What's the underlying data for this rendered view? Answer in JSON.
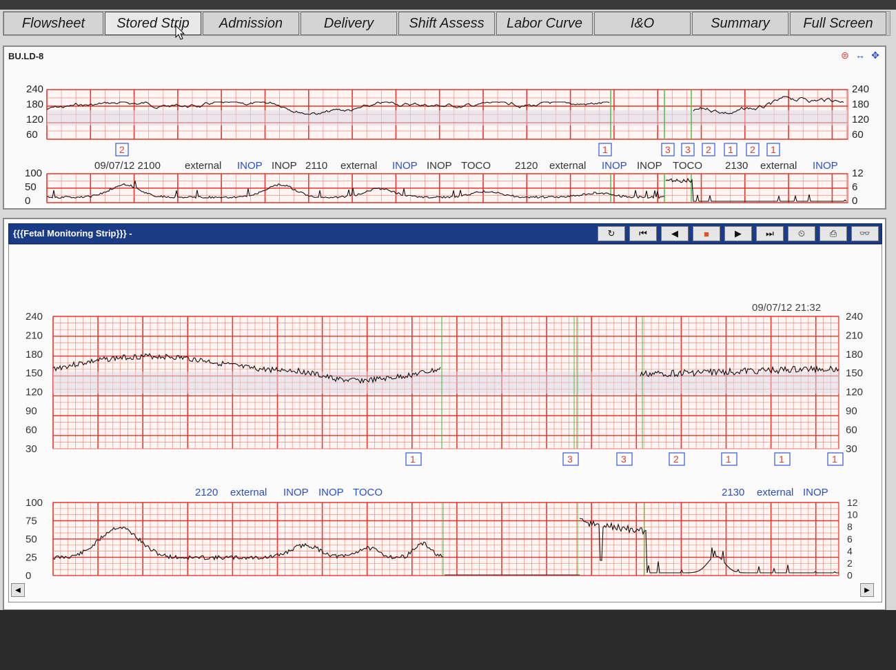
{
  "tabs": [
    {
      "label": "Flowsheet"
    },
    {
      "label": "Stored Strip",
      "active": true
    },
    {
      "label": "Admission"
    },
    {
      "label": "Delivery"
    },
    {
      "label": "Shift Assess"
    },
    {
      "label": "Labor Curve"
    },
    {
      "label": "I&O"
    },
    {
      "label": "Summary"
    },
    {
      "label": "Full Screen"
    }
  ],
  "overview": {
    "bed_label": "BU.LD-8",
    "icons": [
      "record-icon",
      "expand-horizontal-icon",
      "move-icon"
    ],
    "fhr_ticks_left": [
      "240",
      "180",
      "120",
      "60"
    ],
    "fhr_ticks_right": [
      "240",
      "180",
      "120",
      "60"
    ],
    "markers": [
      {
        "label": "2",
        "color": "red"
      },
      {
        "label": "1",
        "color": "red"
      },
      {
        "label": "3",
        "color": "red"
      },
      {
        "label": "3",
        "color": "red"
      },
      {
        "label": "2",
        "color": "red"
      },
      {
        "label": "1",
        "color": "red"
      },
      {
        "label": "2",
        "color": "red"
      },
      {
        "label": "1",
        "color": "red"
      }
    ],
    "annotations": [
      {
        "label": "09/07/12 2100",
        "color": "#333333"
      },
      {
        "label": "external",
        "color": "#333333"
      },
      {
        "label": "INOP",
        "color": "#2a4ecb"
      },
      {
        "label": "INOP",
        "color": "#333333"
      },
      {
        "label": "2110",
        "color": "#333333"
      },
      {
        "label": "external",
        "color": "#333333"
      },
      {
        "label": "INOP",
        "color": "#2a4ecb"
      },
      {
        "label": "INOP",
        "color": "#333333"
      },
      {
        "label": "TOCO",
        "color": "#333333"
      },
      {
        "label": "2120",
        "color": "#333333"
      },
      {
        "label": "external",
        "color": "#333333"
      },
      {
        "label": "INOP",
        "color": "#2a4ecb"
      },
      {
        "label": "INOP",
        "color": "#333333"
      },
      {
        "label": "TOCO",
        "color": "#333333"
      },
      {
        "label": "2130",
        "color": "#333333"
      },
      {
        "label": "external",
        "color": "#333333"
      },
      {
        "label": "INOP",
        "color": "#2a4ecb"
      }
    ],
    "toco_ticks_left": [
      "100",
      "50",
      "0"
    ],
    "toco_ticks_right": [
      "12",
      "6",
      "0"
    ]
  },
  "detail": {
    "title": "{{{Fetal Monitoring Strip}}} -",
    "controls": [
      {
        "name": "refresh-icon",
        "glyph": "↻"
      },
      {
        "name": "first-icon",
        "glyph": "⏮"
      },
      {
        "name": "prev-icon",
        "glyph": "◀"
      },
      {
        "name": "stop-icon",
        "glyph": "■"
      },
      {
        "name": "next-icon",
        "glyph": "▶"
      },
      {
        "name": "last-icon",
        "glyph": "⏭"
      },
      {
        "name": "speed-icon",
        "glyph": "⏲"
      },
      {
        "name": "print-icon",
        "glyph": "⎙"
      },
      {
        "name": "view-icon",
        "glyph": "👓"
      }
    ],
    "timestamp": "09/07/12 21:32",
    "fhr_ticks": [
      "240",
      "210",
      "180",
      "150",
      "120",
      "90",
      "60",
      "30"
    ],
    "markers": [
      {
        "label": "1",
        "color": "red"
      },
      {
        "label": "3",
        "color": "red"
      },
      {
        "label": "3",
        "color": "red"
      },
      {
        "label": "2",
        "color": "red"
      },
      {
        "label": "1",
        "color": "red"
      },
      {
        "label": "1",
        "color": "red"
      },
      {
        "label": "1",
        "color": "red"
      }
    ],
    "annot_left": [
      {
        "label": "2120",
        "color": "#2a4ecb"
      },
      {
        "label": "external",
        "color": "#2a4ecb"
      },
      {
        "label": "INOP",
        "color": "#2a4ecb"
      },
      {
        "label": "INOP",
        "color": "#2a4ecb"
      },
      {
        "label": "TOCO",
        "color": "#2a4ecb"
      }
    ],
    "annot_right": [
      {
        "label": "2130",
        "color": "#2a4ecb"
      },
      {
        "label": "external",
        "color": "#2a4ecb"
      },
      {
        "label": "INOP",
        "color": "#2a4ecb"
      }
    ],
    "toco_ticks_left": [
      "100",
      "75",
      "50",
      "25",
      "0"
    ],
    "toco_ticks_right": [
      "12",
      "10",
      "8",
      "6",
      "4",
      "2",
      "0"
    ]
  },
  "colors": {
    "grid": "#e8342a",
    "grid_minor": "#f08a80",
    "band": "#d9d9e6",
    "trace": "#111111",
    "marker_blue": "#3355dd"
  }
}
